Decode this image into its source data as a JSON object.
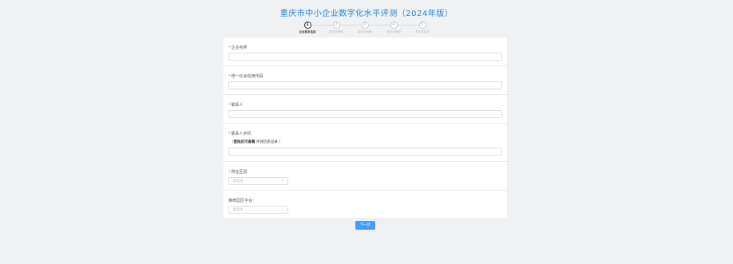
{
  "page": {
    "title": "重庆市中小企业数字化水平评测（2024年版）"
  },
  "steps": [
    {
      "number": "1",
      "label": "企业基本信息"
    },
    {
      "number": "2",
      "label": "数字化基础"
    },
    {
      "number": "3",
      "label": "数字化经营"
    },
    {
      "number": "4",
      "label": "数字化管理"
    },
    {
      "number": "5",
      "label": "数字化成效"
    }
  ],
  "form": {
    "company_name": {
      "required": "*",
      "label": "企业名称",
      "value": ""
    },
    "credit_code": {
      "required": "*",
      "label": "统一社会信用代码",
      "value": ""
    },
    "contact": {
      "required": "*",
      "label": "联系人",
      "value": ""
    },
    "phone": {
      "required": "*",
      "label": "联系人手机",
      "hint_open": "（",
      "hint_bold": "登陆后可查看",
      "hint_rest": " 评测历史记录 ）",
      "value": ""
    },
    "district": {
      "required": "*",
      "label": "所在区县",
      "placeholder": "请选择"
    },
    "platform": {
      "label": "推荐园区平台：",
      "placeholder": "请选择"
    }
  },
  "buttons": {
    "next": "下一步"
  },
  "colors": {
    "accent": "#409eff",
    "title": "#1e88e5",
    "required": "#f56c6c"
  }
}
